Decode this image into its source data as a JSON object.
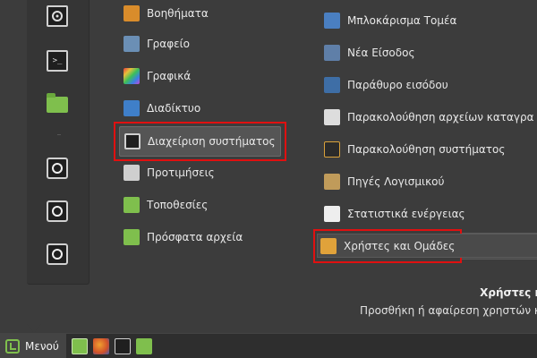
{
  "favorites": [
    {
      "name": "system-settings-icon"
    },
    {
      "name": "terminal-icon"
    },
    {
      "name": "home-folder-icon"
    },
    {
      "name": "lock-screen-icon"
    },
    {
      "name": "logout-icon"
    },
    {
      "name": "shutdown-icon"
    }
  ],
  "categories": [
    {
      "label": "Βοηθήματα",
      "icon": "accessories-icon",
      "color": "#d98c2b"
    },
    {
      "label": "Γραφείο",
      "icon": "office-icon",
      "color": "#6b8fb5"
    },
    {
      "label": "Γραφικά",
      "icon": "graphics-icon",
      "color": "#c44bd6"
    },
    {
      "label": "Διαδίκτυο",
      "icon": "internet-icon",
      "color": "#3f7fc9"
    },
    {
      "label": "Διαχείριση συστήματος",
      "icon": "administration-icon",
      "color": "#888888",
      "selected": true
    },
    {
      "label": "Προτιμήσεις",
      "icon": "preferences-icon",
      "color": "#cccccc"
    },
    {
      "label": "Τοποθεσίες",
      "icon": "places-icon",
      "color": "#7fbf4d"
    },
    {
      "label": "Πρόσφατα αρχεία",
      "icon": "recent-files-icon",
      "color": "#7fbf4d"
    }
  ],
  "apps": [
    {
      "label": "Μπλοκάρισμα Τομέα",
      "icon": "domain-blocker-icon",
      "color": "#4a7fc1"
    },
    {
      "label": "Νέα Είσοδος",
      "icon": "new-login-icon",
      "color": "#5f7fa8"
    },
    {
      "label": "Παράθυρο εισόδου",
      "icon": "login-window-icon",
      "color": "#3e6ea6"
    },
    {
      "label": "Παρακολούθηση αρχείων καταγρα",
      "icon": "log-viewer-icon",
      "color": "#dddddd"
    },
    {
      "label": "Παρακολούθηση συστήματος",
      "icon": "system-monitor-icon",
      "color": "#d9a13b"
    },
    {
      "label": "Πηγές Λογισμικού",
      "icon": "software-sources-icon",
      "color": "#c09b5a"
    },
    {
      "label": "Στατιστικά ενέργειας",
      "icon": "power-statistics-icon",
      "color": "#dddddd"
    },
    {
      "label": "Χρήστες και Ομάδες",
      "icon": "users-groups-icon",
      "color": "#e0a23a",
      "selected": true
    }
  ],
  "description": {
    "title": "Χρήστες κ",
    "text": "Προσθήκη ή αφαίρεση χρηστών κ"
  },
  "taskbar": {
    "menu_label": "Μενού"
  }
}
